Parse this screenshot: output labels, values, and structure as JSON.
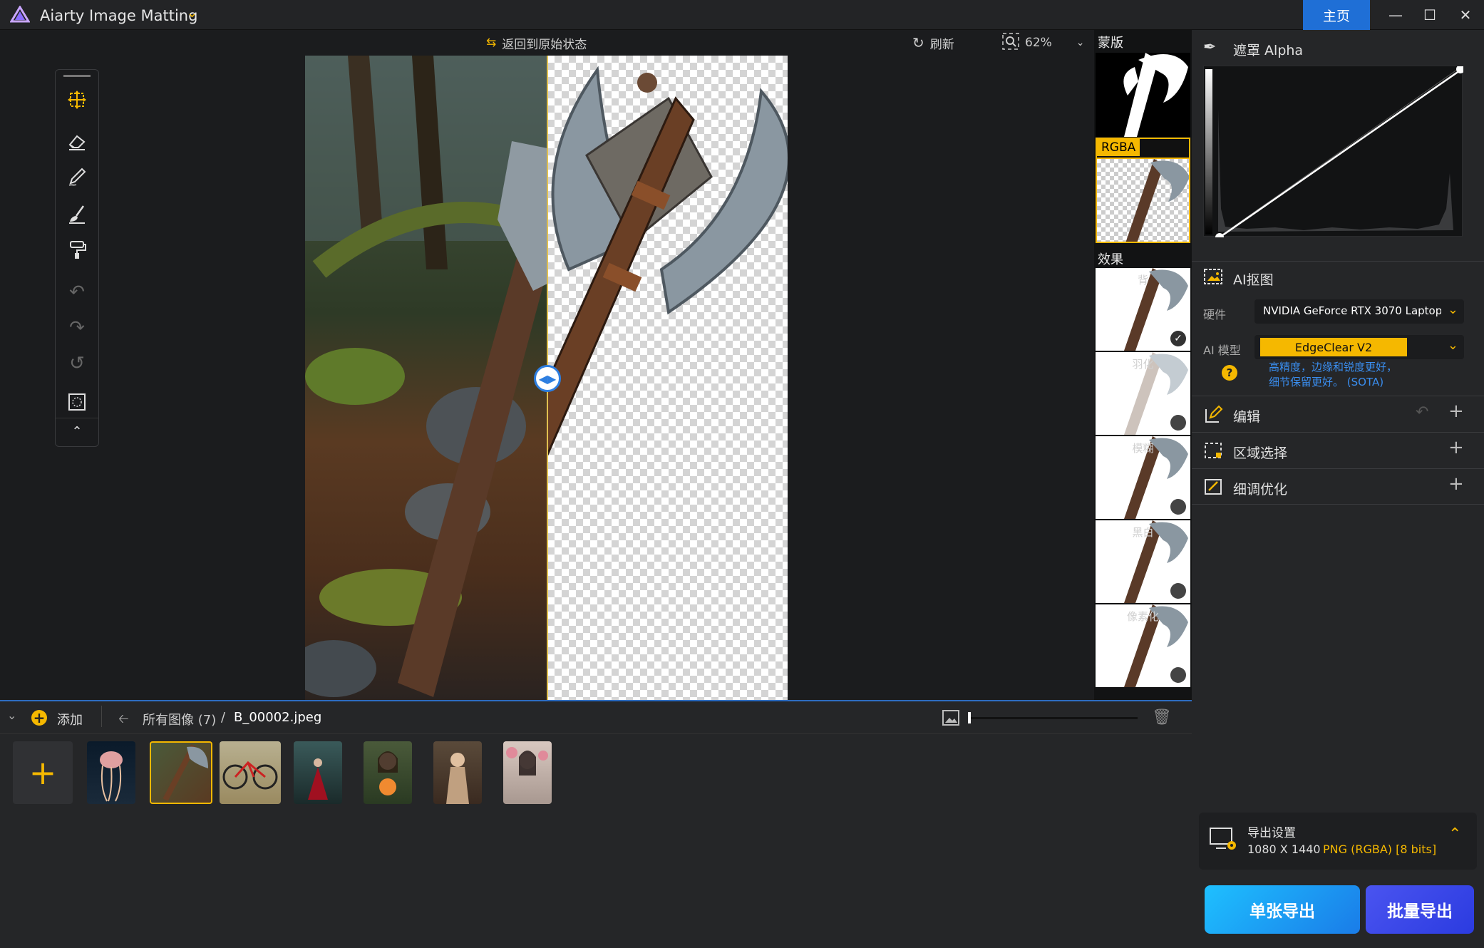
{
  "app": {
    "title": "Aiarty Image Matting",
    "home": "主页"
  },
  "toolbar": {
    "revert": "返回到原始状态",
    "refresh": "刷新",
    "zoom": "62%"
  },
  "thumbs": {
    "mask_label": "蒙版",
    "rgba_label": "RGBA",
    "effects_label": "效果",
    "effects": [
      "背",
      "羽化",
      "模糊",
      "黑白",
      "像素化"
    ]
  },
  "right_panel": {
    "alpha_title": "遮罩 Alpha",
    "ai_title": "AI抠图",
    "hardware_label": "硬件",
    "hardware_value": "NVIDIA GeForce RTX 3070 Laptop",
    "model_label": "AI 模型",
    "model_value": "EdgeClear  V2",
    "model_desc1": "高精度，边缘和锐度更好，",
    "model_desc2": "细节保留更好。 (SOTA)",
    "edit": "编辑",
    "region": "区域选择",
    "refine": "细调优化",
    "export_title": "导出设置",
    "export_size": "1080 X 1440",
    "export_format": "PNG (RGBA) [8 bits]",
    "btn_single": "单张导出",
    "btn_batch": "批量导出"
  },
  "bottom": {
    "add": "添加",
    "all_images": "所有图像 (7)",
    "separator": "/",
    "current_file": "B_00002.jpeg"
  },
  "colors": {
    "accent": "#f5b800",
    "blue": "#1f6fd6",
    "link": "#3a8ef0"
  }
}
